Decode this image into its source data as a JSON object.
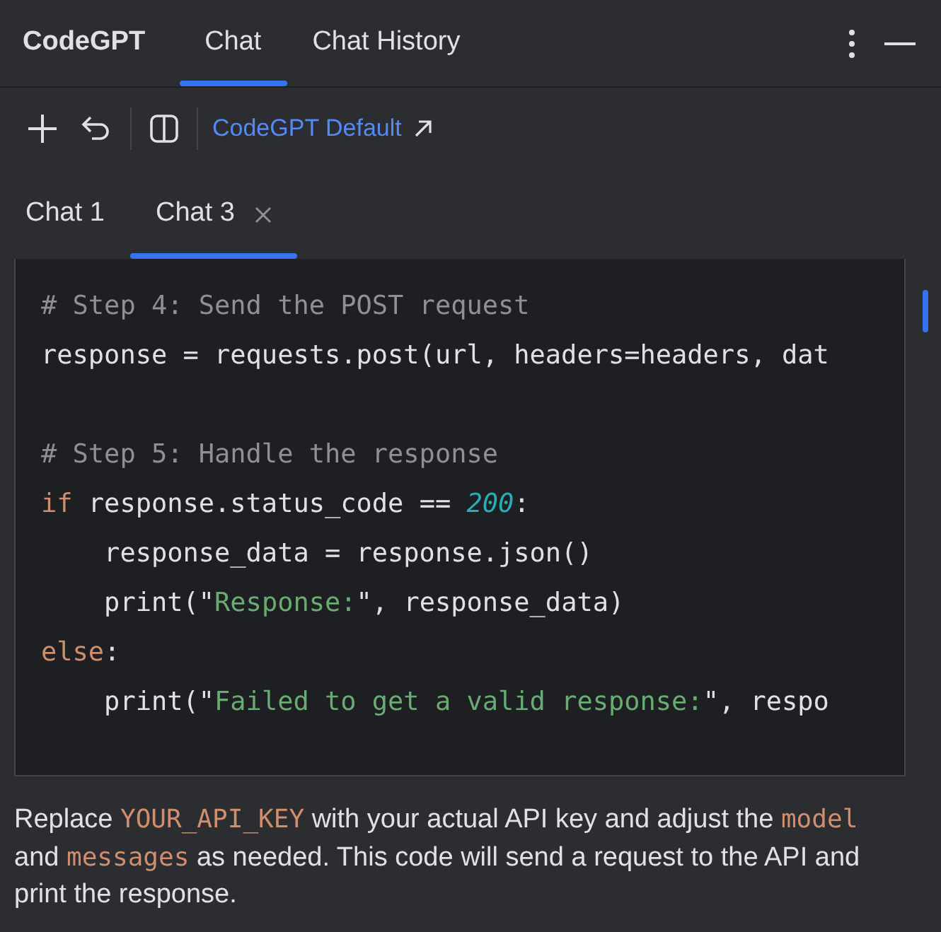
{
  "header": {
    "title": "CodeGPT",
    "tabs": [
      {
        "label": "Chat",
        "selected": true
      },
      {
        "label": "Chat History",
        "selected": false
      }
    ]
  },
  "toolbar": {
    "model_link": "CodeGPT Default"
  },
  "chat_tabs": [
    {
      "label": "Chat 1",
      "selected": false,
      "closable": false
    },
    {
      "label": "Chat 3",
      "selected": true,
      "closable": true
    }
  ],
  "code_lines": [
    {
      "kind": "code",
      "tokens": [
        {
          "kind": "comment",
          "text": "# Step 4: Send the POST request"
        }
      ]
    },
    {
      "kind": "code",
      "tokens": [
        {
          "kind": "plain",
          "text": "response = requests.post(url, headers=headers, dat"
        }
      ]
    },
    {
      "kind": "blank"
    },
    {
      "kind": "code",
      "tokens": [
        {
          "kind": "comment",
          "text": "# Step 5: Handle the response"
        }
      ]
    },
    {
      "kind": "code",
      "tokens": [
        {
          "kind": "keyword",
          "text": "if"
        },
        {
          "kind": "plain",
          "text": " response.status_code == "
        },
        {
          "kind": "number",
          "text": "200"
        },
        {
          "kind": "plain",
          "text": ":"
        }
      ]
    },
    {
      "kind": "code",
      "tokens": [
        {
          "kind": "plain",
          "text": "    response_data = response.json()"
        }
      ]
    },
    {
      "kind": "code",
      "tokens": [
        {
          "kind": "plain",
          "text": "    print(\""
        },
        {
          "kind": "string",
          "text": "Response:"
        },
        {
          "kind": "plain",
          "text": "\", response_data)"
        }
      ]
    },
    {
      "kind": "code",
      "tokens": [
        {
          "kind": "keyword",
          "text": "else"
        },
        {
          "kind": "plain",
          "text": ":"
        }
      ]
    },
    {
      "kind": "code",
      "tokens": [
        {
          "kind": "plain",
          "text": "    print(\""
        },
        {
          "kind": "string",
          "text": "Failed to get a valid response:"
        },
        {
          "kind": "plain",
          "text": "\", respo"
        }
      ]
    }
  ],
  "message": [
    {
      "kind": "text",
      "text": "Replace "
    },
    {
      "kind": "code",
      "text": "YOUR_API_KEY"
    },
    {
      "kind": "text",
      "text": " with your actual API key and adjust the "
    },
    {
      "kind": "code",
      "text": "model"
    },
    {
      "kind": "text",
      "text": " and "
    },
    {
      "kind": "code",
      "text": "messages"
    },
    {
      "kind": "text",
      "text": " as needed. This code will send a request to the API and print the response."
    }
  ]
}
